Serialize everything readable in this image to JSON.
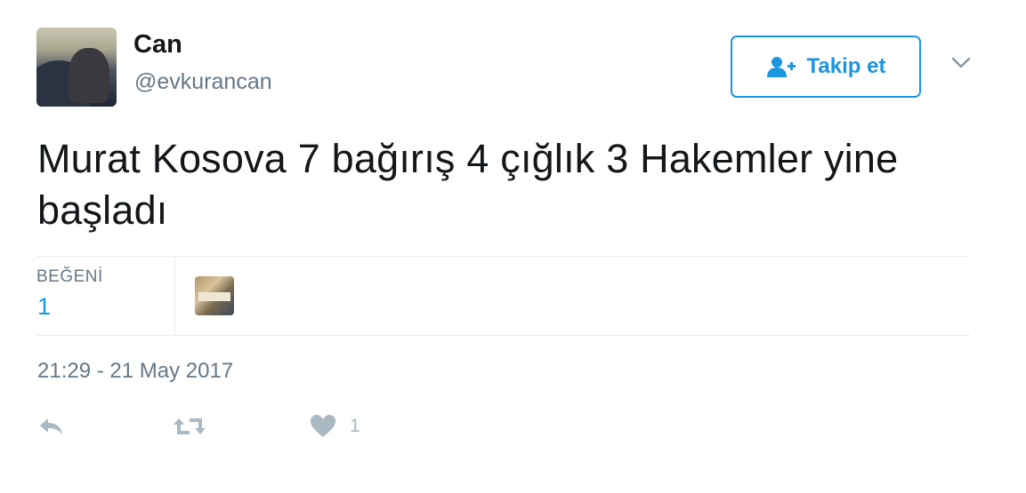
{
  "user": {
    "display_name": "Can",
    "handle": "@evkurancan"
  },
  "follow_button": {
    "label": "Takip et",
    "icon": "add-user-icon"
  },
  "menu": {
    "icon": "chevron-down-icon"
  },
  "tweet": {
    "text": "Murat Kosova 7 bağırış 4 çığlık 3 Hakemler yine başladı"
  },
  "stats": {
    "likes_label": "BEĞENİ",
    "likes_count": "1"
  },
  "timestamp": "21:29 - 21 May 2017",
  "actions": {
    "reply_icon": "reply-icon",
    "retweet_icon": "retweet-icon",
    "like_icon": "heart-icon",
    "like_count": "1"
  },
  "colors": {
    "accent": "#1b95e0",
    "secondary_text": "#657786",
    "action_icon": "#aab8c2",
    "divider": "#e6ecf0"
  }
}
